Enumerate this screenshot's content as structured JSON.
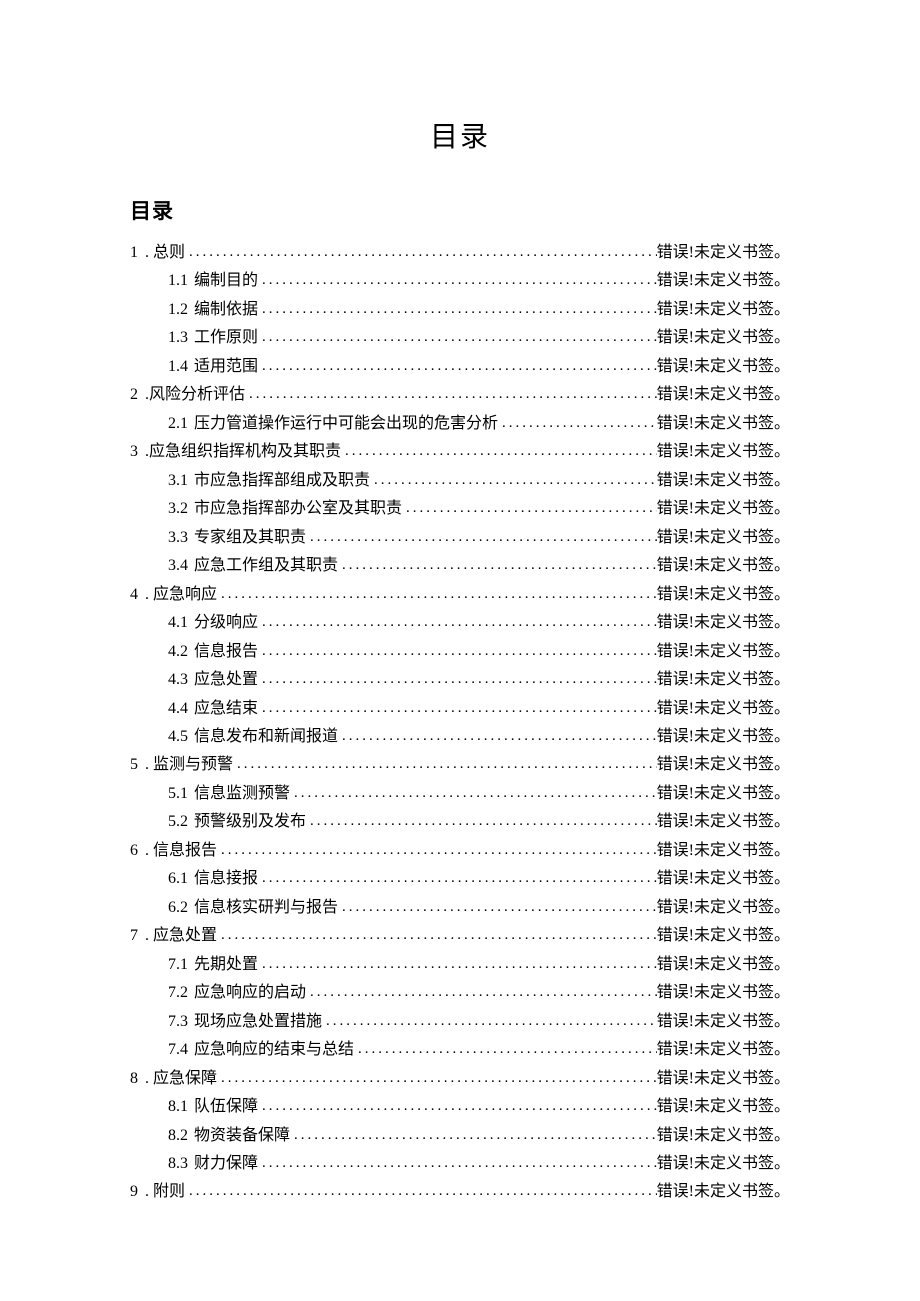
{
  "title": "目录",
  "subtitle": "目录",
  "error_text": "错误!未定义书签。",
  "toc": [
    {
      "level": 1,
      "num": "1",
      "label": ". 总则"
    },
    {
      "level": 2,
      "num": "1.1",
      "label": "编制目的"
    },
    {
      "level": 2,
      "num": "1.2",
      "label": "编制依据"
    },
    {
      "level": 2,
      "num": "1.3",
      "label": "工作原则"
    },
    {
      "level": 2,
      "num": "1.4",
      "label": "适用范围"
    },
    {
      "level": 1,
      "num": "2",
      "label": ".风险分析评估"
    },
    {
      "level": 2,
      "num": "2.1",
      "label": "压力管道操作运行中可能会出现的危害分析"
    },
    {
      "level": 1,
      "num": "3",
      "label": ".应急组织指挥机构及其职责"
    },
    {
      "level": 2,
      "num": "3.1",
      "label": "市应急指挥部组成及职责"
    },
    {
      "level": 2,
      "num": "3.2",
      "label": "市应急指挥部办公室及其职责"
    },
    {
      "level": 2,
      "num": "3.3",
      "label": "专家组及其职责"
    },
    {
      "level": 2,
      "num": "3.4",
      "label": "应急工作组及其职责"
    },
    {
      "level": 1,
      "num": "4",
      "label": ". 应急响应"
    },
    {
      "level": 2,
      "num": "4.1",
      "label": "分级响应"
    },
    {
      "level": 2,
      "num": "4.2",
      "label": "信息报告"
    },
    {
      "level": 2,
      "num": "4.3",
      "label": "应急处置"
    },
    {
      "level": 2,
      "num": "4.4",
      "label": "应急结束"
    },
    {
      "level": 2,
      "num": "4.5",
      "label": "信息发布和新闻报道"
    },
    {
      "level": 1,
      "num": "5",
      "label": ". 监测与预警"
    },
    {
      "level": 2,
      "num": "5.1",
      "label": "信息监测预警"
    },
    {
      "level": 2,
      "num": "5.2",
      "label": "预警级别及发布"
    },
    {
      "level": 1,
      "num": "6",
      "label": ". 信息报告"
    },
    {
      "level": 2,
      "num": "6.1",
      "label": "信息接报"
    },
    {
      "level": 2,
      "num": "6.2",
      "label": "信息核实研判与报告"
    },
    {
      "level": 1,
      "num": "7",
      "label": ". 应急处置"
    },
    {
      "level": 2,
      "num": "7.1",
      "label": "先期处置"
    },
    {
      "level": 2,
      "num": "7.2",
      "label": "应急响应的启动"
    },
    {
      "level": 2,
      "num": "7.3",
      "label": "现场应急处置措施"
    },
    {
      "level": 2,
      "num": "7.4",
      "label": "应急响应的结束与总结"
    },
    {
      "level": 1,
      "num": "8",
      "label": ". 应急保障"
    },
    {
      "level": 2,
      "num": "8.1",
      "label": "队伍保障"
    },
    {
      "level": 2,
      "num": "8.2",
      "label": "物资装备保障"
    },
    {
      "level": 2,
      "num": "8.3",
      "label": "财力保障"
    },
    {
      "level": 1,
      "num": "9",
      "label": ". 附则"
    }
  ]
}
